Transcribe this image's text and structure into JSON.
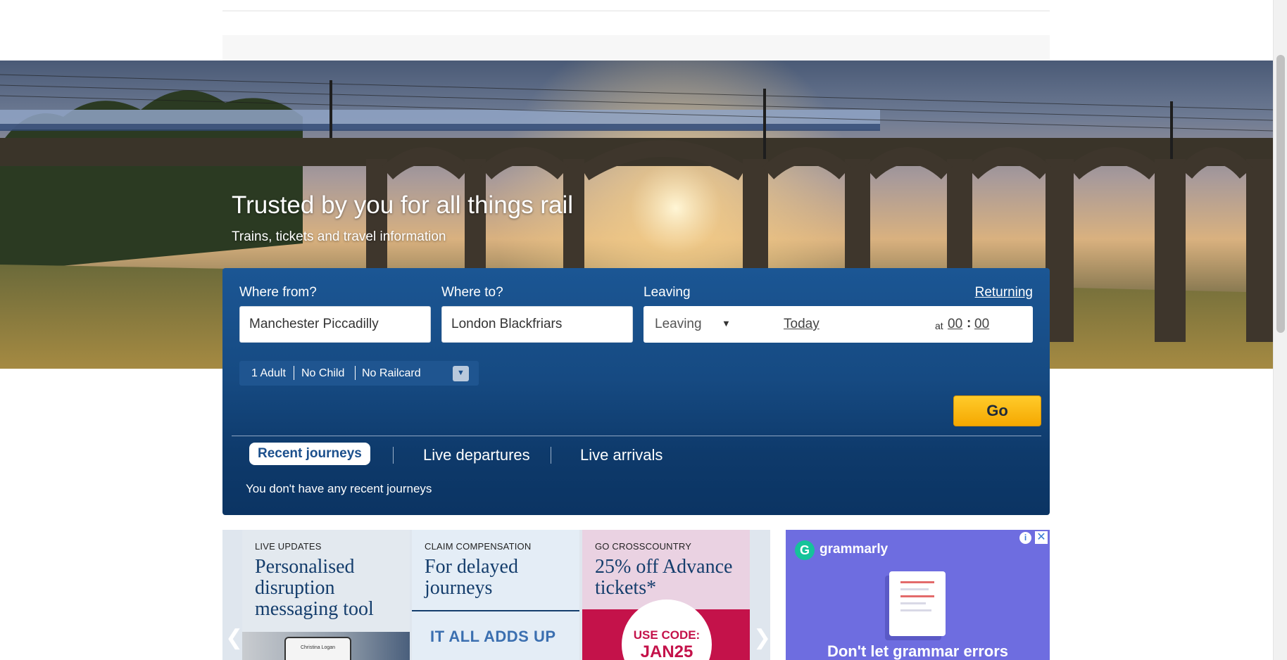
{
  "hero": {
    "title": "Trusted by you for all things rail",
    "subtitle": "Trains, tickets and travel information"
  },
  "search": {
    "from_label": "Where from?",
    "from_value": "Manchester Piccadilly",
    "to_label": "Where to?",
    "to_value": "London Blackfriars",
    "leaving_label": "Leaving",
    "returning_link": "Returning",
    "leaving_select": "Leaving",
    "date": "Today",
    "at": "at",
    "hour": "00",
    "minute": "00",
    "passengers": {
      "adults": "1 Adult",
      "children": "No Child",
      "railcard": "No Railcard"
    },
    "go_label": "Go"
  },
  "tabs": {
    "recent": "Recent journeys",
    "departures": "Live departures",
    "arrivals": "Live arrivals",
    "empty_message": "You don't have any recent journeys"
  },
  "promos": [
    {
      "kicker": "LIVE UPDATES",
      "headline": "Personalised disruption messaging tool",
      "phone_text": "Christina Logan"
    },
    {
      "kicker": "CLAIM COMPENSATION",
      "headline": "For delayed journeys",
      "banner": "IT ALL ADDS UP"
    },
    {
      "kicker": "GO CROSSCOUNTRY",
      "headline": "25% off Advance tickets*",
      "code_label": "USE CODE:",
      "code": "JAN25"
    }
  ],
  "ad": {
    "brand": "grammarly",
    "logo_letter": "G",
    "tagline": "Don't let grammar errors",
    "colors": {
      "background": "#6e6de0",
      "logo": "#15c39a"
    }
  },
  "colors": {
    "panel": "#164a82",
    "go_button": "#ffc20e",
    "accent_text": "#1b4f8c"
  }
}
